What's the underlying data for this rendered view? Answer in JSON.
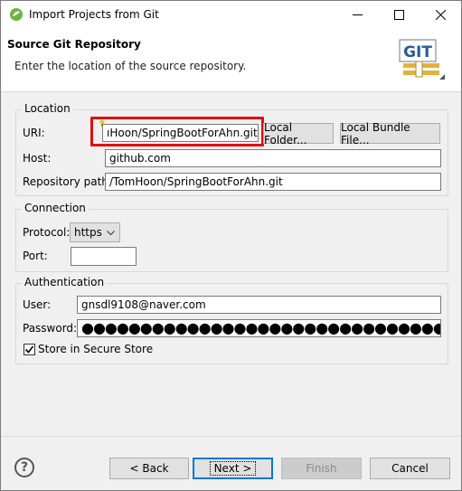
{
  "window": {
    "title": "Import Projects from Git"
  },
  "header": {
    "title": "Source Git Repository",
    "description": "Enter the location of the source repository.",
    "logo_text": "GIT"
  },
  "location": {
    "group_label": "Location",
    "uri_label": "URI:",
    "uri_value": "ıHoon/SpringBootForAhn.git",
    "local_folder_button": "Local Folder...",
    "local_bundle_button": "Local Bundle File...",
    "host_label": "Host:",
    "host_value": "github.com",
    "repo_path_label": "Repository path:",
    "repo_path_value": "/TomHoon/SpringBootForAhn.git"
  },
  "connection": {
    "group_label": "Connection",
    "protocol_label": "Protocol:",
    "protocol_value": "https",
    "port_label": "Port:",
    "port_value": ""
  },
  "authentication": {
    "group_label": "Authentication",
    "user_label": "User:",
    "user_value": "gnsdl9108@naver.com",
    "password_label": "Password:",
    "password_mask": "●●●●●●●●●●●●●●●●●●●●●●●●●●●●●●●●●●●●●",
    "store_label": "Store in Secure Store",
    "store_checked": true
  },
  "footer": {
    "help": "?",
    "back_button": "< Back",
    "next_button": "Next >",
    "finish_button": "Finish",
    "cancel_button": "Cancel"
  },
  "colors": {
    "highlight": "#e01010",
    "accent": "#0078d7"
  }
}
